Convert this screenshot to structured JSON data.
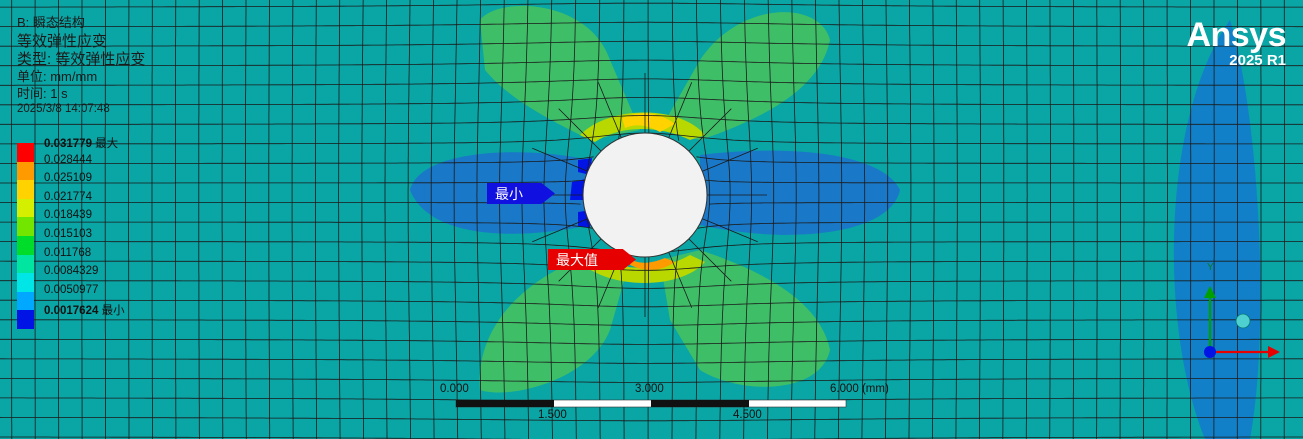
{
  "header": {
    "analysis": "B: 瞬态结构",
    "result_name": "等效弹性应变",
    "result_type": "类型: 等效弹性应变",
    "unit": "单位: mm/mm",
    "time": "时间: 1 s",
    "timestamp": "2025/3/8 14:07:48"
  },
  "legend": {
    "items": [
      {
        "value": "0.031779",
        "suffix": " 最大",
        "bold": true,
        "color": "#ff0000"
      },
      {
        "value": "0.028444",
        "suffix": "",
        "bold": false,
        "color": "#ff9a00"
      },
      {
        "value": "0.025109",
        "suffix": "",
        "bold": false,
        "color": "#ffd200"
      },
      {
        "value": "0.021774",
        "suffix": "",
        "bold": false,
        "color": "#d4f000"
      },
      {
        "value": "0.018439",
        "suffix": "",
        "bold": false,
        "color": "#73e600"
      },
      {
        "value": "0.015103",
        "suffix": "",
        "bold": false,
        "color": "#00dc2a"
      },
      {
        "value": "0.011768",
        "suffix": "",
        "bold": false,
        "color": "#00e6a0"
      },
      {
        "value": "0.0084329",
        "suffix": "",
        "bold": false,
        "color": "#00e6e6"
      },
      {
        "value": "0.0050977",
        "suffix": "",
        "bold": false,
        "color": "#00a8ff"
      },
      {
        "value": "0.0017624",
        "suffix": " 最小",
        "bold": true,
        "color": "#0014e6"
      }
    ]
  },
  "probes": {
    "min_label": "最小",
    "max_label": "最大值"
  },
  "scale_bar": {
    "top_labels": [
      "0.000",
      "3.000",
      "6.000 (mm)"
    ],
    "bottom_labels": [
      "1.500",
      "4.500"
    ]
  },
  "logo": {
    "brand": "Ansys",
    "version": "2025 R1"
  },
  "triad": {
    "y_label": "Y"
  },
  "colors": {
    "background": "#0aa5a5",
    "hole": "#f2f2f2",
    "mesh": "#1a1a1a"
  }
}
